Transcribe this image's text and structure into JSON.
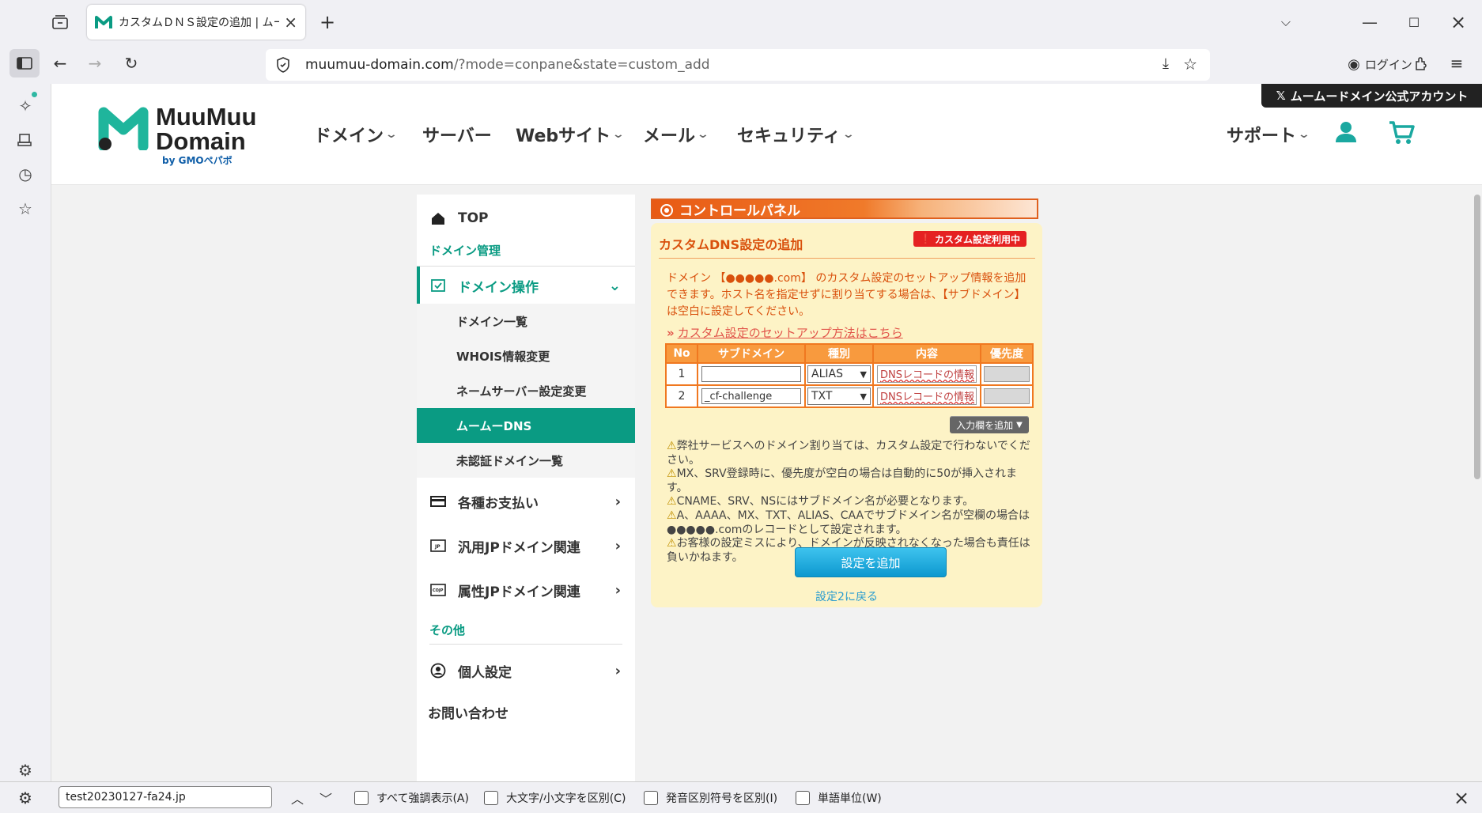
{
  "browser": {
    "tab_title": "カスタムＤＮＳ設定の追加 | ムーム",
    "url_domain": "muumuu-domain.com",
    "url_path": "/?mode=conpane&state=custom_add",
    "login_label": "ログイン"
  },
  "site": {
    "logo_line1": "MuuMuu",
    "logo_line2": "Domain",
    "logo_sub": "by GMOペパボ",
    "promo": "ムームードメイン公式アカウント",
    "nav": [
      "ドメイン",
      "サーバー",
      "Webサイト",
      "メール",
      "セキュリティ",
      "サポート"
    ]
  },
  "leftnav": {
    "top": "TOP",
    "section_domain": "ドメイン管理",
    "domain_ops": "ドメイン操作",
    "subitems": [
      "ドメイン一覧",
      "WHOIS情報変更",
      "ネームサーバー設定変更",
      "ムームーDNS",
      "未認証ドメイン一覧"
    ],
    "payments": "各種お支払い",
    "jp_general": "汎用JPドメイン関連",
    "jp_attr": "属性JPドメイン関連",
    "section_other": "その他",
    "personal": "個人設定",
    "contact": "お問い合わせ"
  },
  "panel": {
    "header": "コントロールパネル",
    "title": "カスタムDNS設定の追加",
    "badge": "カスタム設定利用中",
    "description": "ドメイン 【●●●●●.com】 のカスタム設定のセットアップ情報を追加できます。ホスト名を指定せずに割り当てする場合は、【サブドメイン】は空白に設定してください。",
    "howto_link": "カスタム設定のセットアップ方法はこちら",
    "table": {
      "headers": [
        "No",
        "サブドメイン",
        "種別",
        "内容",
        "優先度"
      ],
      "rows": [
        {
          "no": "1",
          "subdomain": "",
          "type": "ALIAS",
          "content": "DNSレコードの情報"
        },
        {
          "no": "2",
          "subdomain": "_cf-challenge",
          "type": "TXT",
          "content": "DNSレコードの情報"
        }
      ]
    },
    "add_row_button": "入力欄を追加",
    "notes": [
      "弊社サービスへのドメイン割り当ては、カスタム設定で行わないでください。",
      "MX、SRV登録時に、優先度が空白の場合は自動的に50が挿入されます。",
      "CNAME、SRV、NSにはサブドメイン名が必要となります。",
      "A、AAAA、MX、TXT、ALIAS、CAAでサブドメイン名が空欄の場合は●●●●●.comのレコードとして設定されます。",
      "お客様の設定ミスにより、ドメインが反映されなくなった場合も責任は負いかねます。"
    ],
    "submit_button": "設定を追加",
    "back_link": "設定2に戻る"
  },
  "findbar": {
    "query": "test20230127-fa24.jp",
    "options": [
      "すべて強調表示(A)",
      "大文字/小文字を区別(C)",
      "発音区別符号を区別(I)",
      "単語単位(W)"
    ]
  }
}
